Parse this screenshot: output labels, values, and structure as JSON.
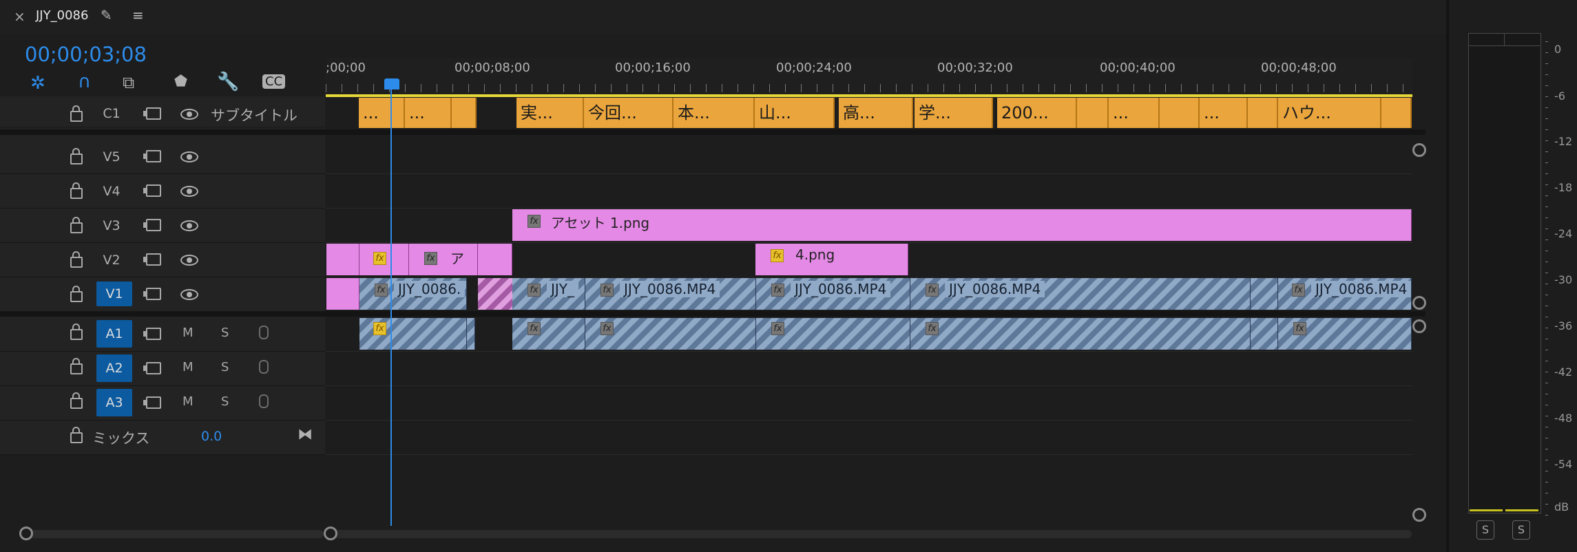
{
  "sequence": {
    "name": "JJY_0086",
    "timecode": "00;00;03;08"
  },
  "ruler": {
    "ticks": [
      ";00;00",
      "00;00;08;00",
      "00;00;16;00",
      "00;00;24;00",
      "00;00;32;00",
      "00;00;40;00",
      "00;00;48;00"
    ]
  },
  "tracks": {
    "c1": {
      "label": "C1",
      "name": "サブタイトル"
    },
    "video": [
      "V5",
      "V4",
      "V3",
      "V2",
      "V1"
    ],
    "audio": [
      "A1",
      "A2",
      "A3"
    ],
    "mute_label": "M",
    "solo_label": "S",
    "mix": {
      "label": "ミックス",
      "value": "0.0"
    }
  },
  "clips": {
    "captions": [
      "...",
      "...",
      "実...",
      "今回...",
      "本...",
      "山...",
      "高...",
      "学...",
      "200...",
      "...",
      "...",
      "ハウ..."
    ],
    "v3": "アセット 1.png",
    "v2a": "ア",
    "v2b": "4.png",
    "v1": [
      "JJY_0086.",
      "JJY_",
      "JJY_0086.MP4",
      "JJY_0086.MP4",
      "JJY_0086.MP4",
      "JJY_0086.MP4"
    ],
    "fx": "fx"
  },
  "meter": {
    "db_labels": [
      "0",
      "-6",
      "-12",
      "-18",
      "-24",
      "-30",
      "-36",
      "-42",
      "-48",
      "-54",
      "dB"
    ],
    "solo_buttons": [
      "S",
      "S"
    ]
  },
  "colors": {
    "accent": "#2d8ceb",
    "caption": "#eaa53c",
    "graphic": "#e589e6",
    "video": "#8fa9c7",
    "selected_track": "#0c5aa0"
  }
}
